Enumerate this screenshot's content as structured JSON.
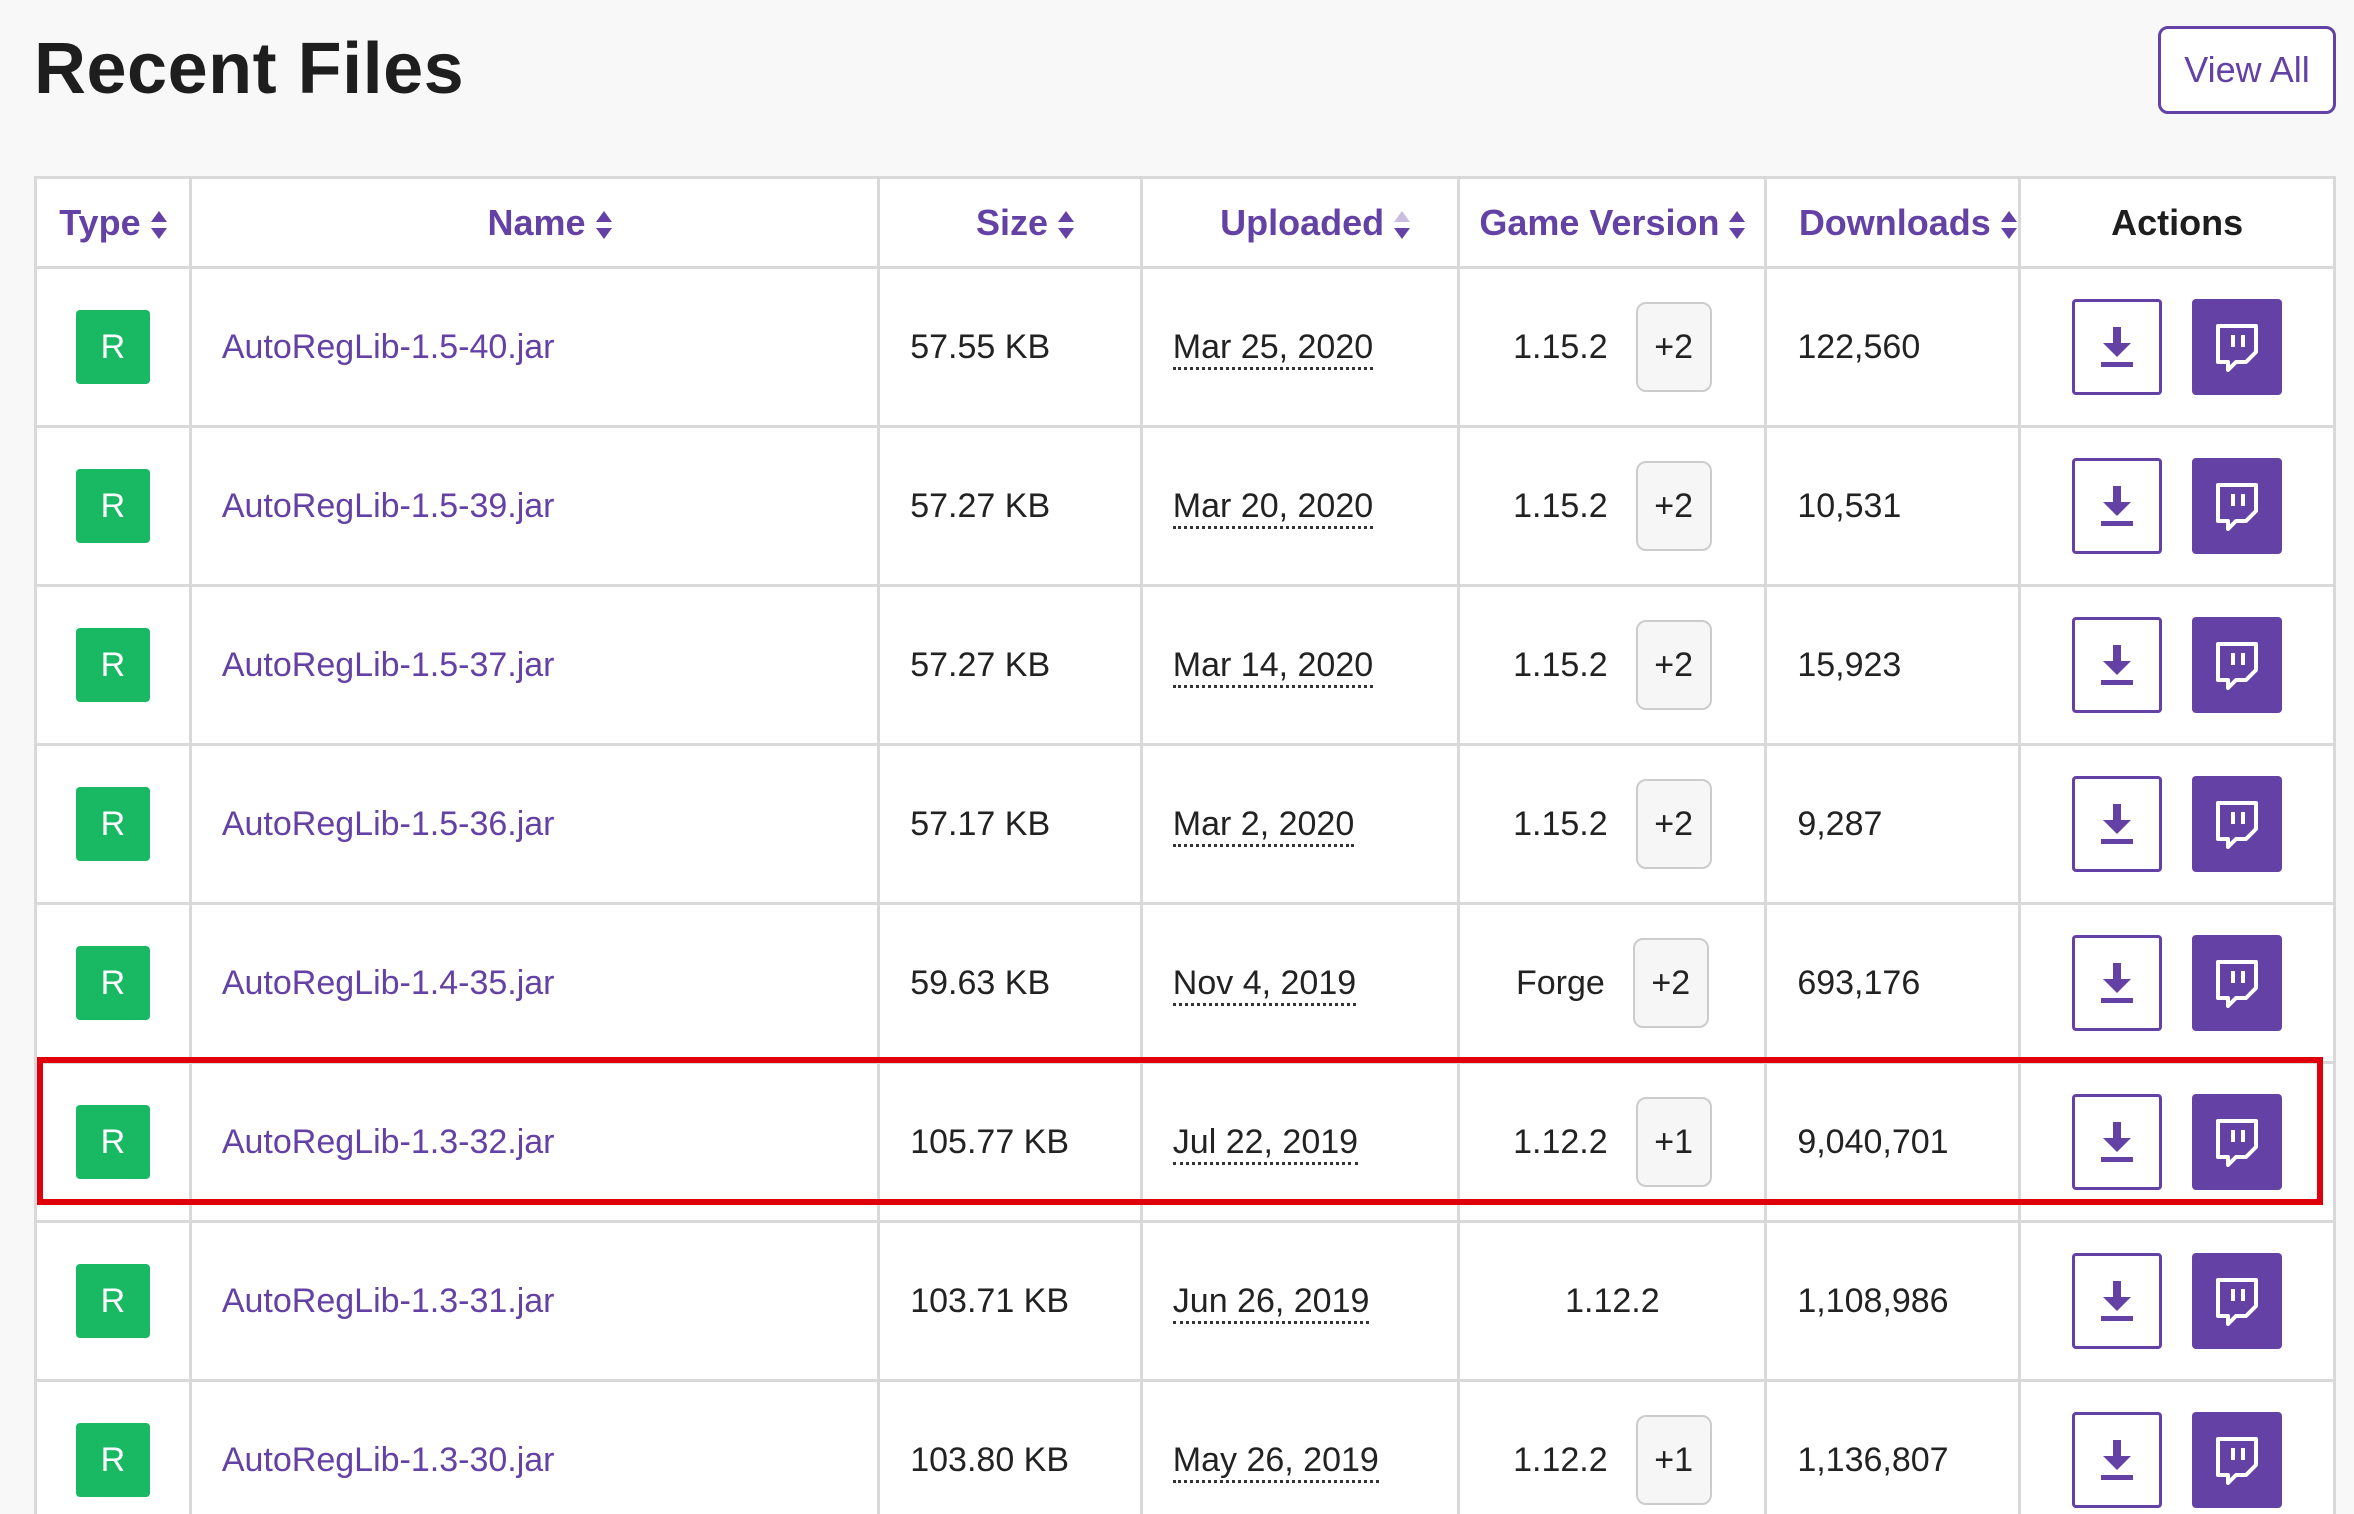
{
  "page": {
    "title": "Recent Files",
    "view_all_label": "View All"
  },
  "table": {
    "headers": {
      "type": "Type",
      "name": "Name",
      "size": "Size",
      "uploaded": "Uploaded",
      "game_version": "Game Version",
      "downloads": "Downloads",
      "actions": "Actions"
    },
    "rows": [
      {
        "type": "R",
        "name": "AutoRegLib-1.5-40.jar",
        "size": "57.55 KB",
        "uploaded": "Mar 25, 2020",
        "game_version": "1.15.2",
        "extra_versions": "+2",
        "downloads": "122,560"
      },
      {
        "type": "R",
        "name": "AutoRegLib-1.5-39.jar",
        "size": "57.27 KB",
        "uploaded": "Mar 20, 2020",
        "game_version": "1.15.2",
        "extra_versions": "+2",
        "downloads": "10,531"
      },
      {
        "type": "R",
        "name": "AutoRegLib-1.5-37.jar",
        "size": "57.27 KB",
        "uploaded": "Mar 14, 2020",
        "game_version": "1.15.2",
        "extra_versions": "+2",
        "downloads": "15,923"
      },
      {
        "type": "R",
        "name": "AutoRegLib-1.5-36.jar",
        "size": "57.17 KB",
        "uploaded": "Mar 2, 2020",
        "game_version": "1.15.2",
        "extra_versions": "+2",
        "downloads": "9,287"
      },
      {
        "type": "R",
        "name": "AutoRegLib-1.4-35.jar",
        "size": "59.63 KB",
        "uploaded": "Nov 4, 2019",
        "game_version": "Forge",
        "extra_versions": "+2",
        "downloads": "693,176"
      },
      {
        "type": "R",
        "name": "AutoRegLib-1.3-32.jar",
        "size": "105.77 KB",
        "uploaded": "Jul 22, 2019",
        "game_version": "1.12.2",
        "extra_versions": "+1",
        "downloads": "9,040,701",
        "highlighted": true
      },
      {
        "type": "R",
        "name": "AutoRegLib-1.3-31.jar",
        "size": "103.71 KB",
        "uploaded": "Jun 26, 2019",
        "game_version": "1.12.2",
        "extra_versions": "",
        "downloads": "1,108,986"
      },
      {
        "type": "R",
        "name": "AutoRegLib-1.3-30.jar",
        "size": "103.80 KB",
        "uploaded": "May 26, 2019",
        "game_version": "1.12.2",
        "extra_versions": "+1",
        "downloads": "1,136,807"
      }
    ]
  },
  "colors": {
    "brand_purple": "#6441a5",
    "release_green": "#19b863",
    "highlight_red": "#e0000b"
  },
  "icons": {
    "download": "download-icon",
    "twitch": "twitch-icon"
  }
}
